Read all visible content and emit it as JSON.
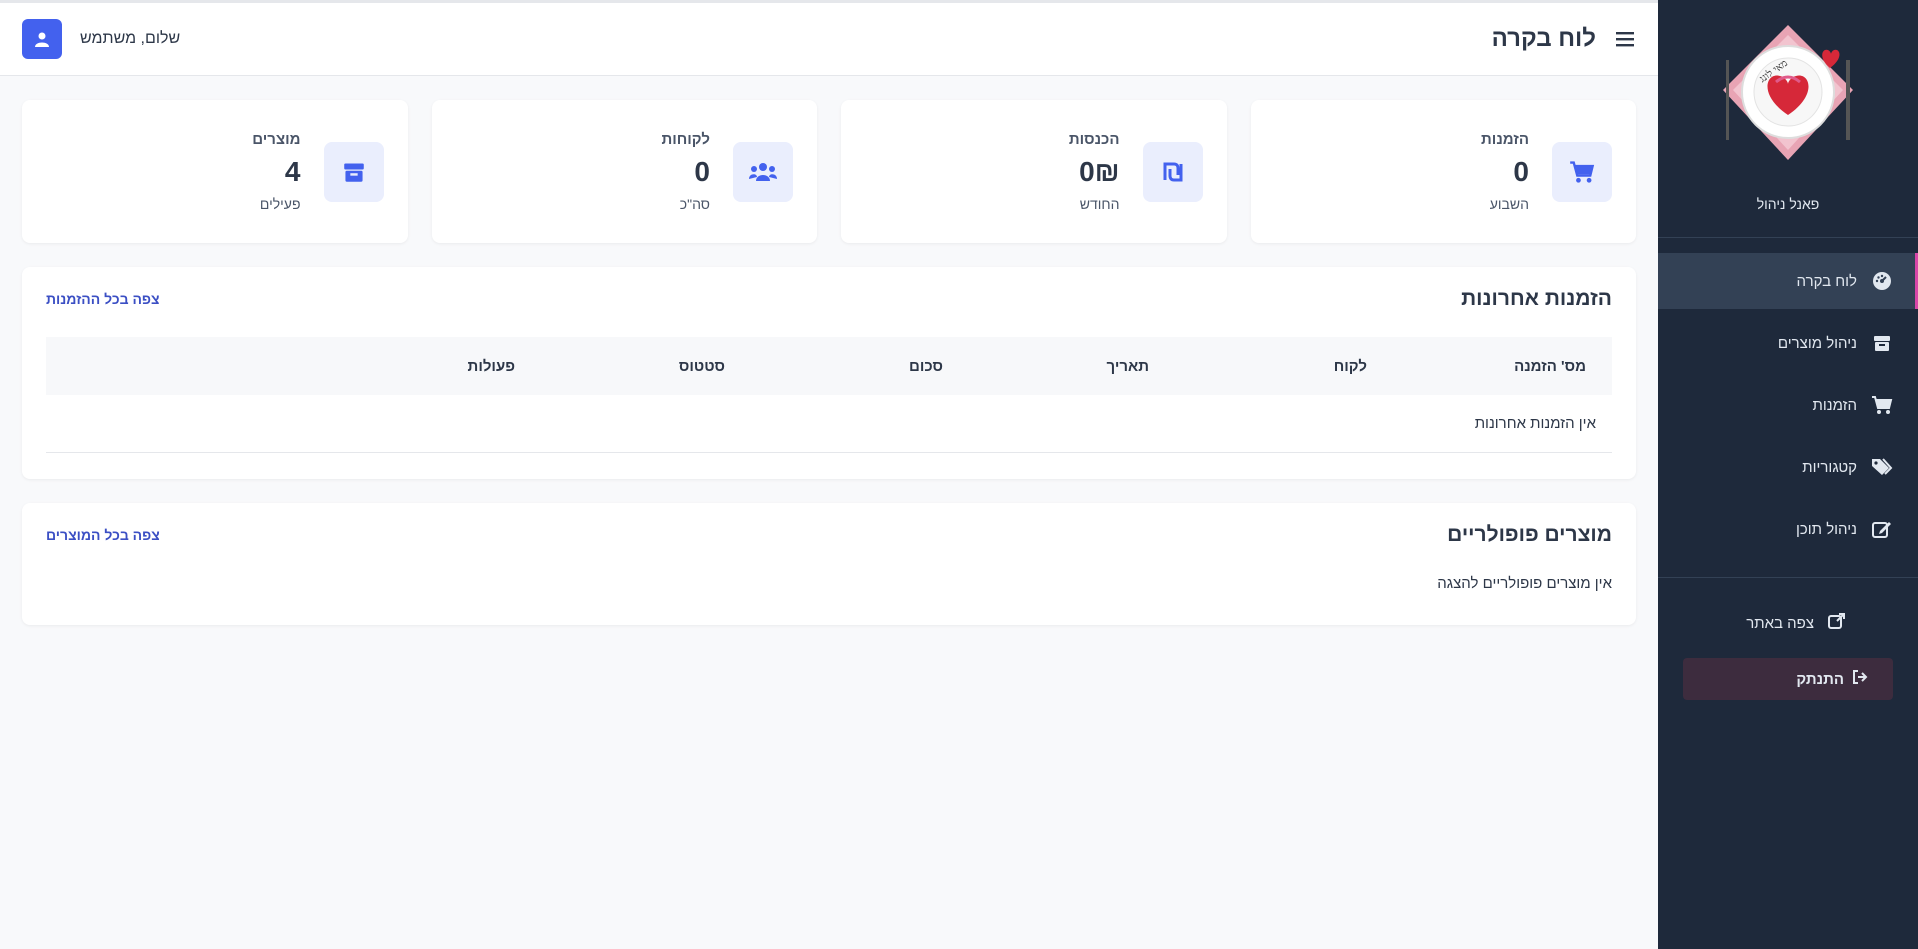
{
  "sidebar": {
    "logo_text": "מאי לונג",
    "panel_label": "פאנל ניהול",
    "items": [
      {
        "label": "לוח בקרה",
        "icon": "tachometer-icon",
        "active": true
      },
      {
        "label": "ניהול מוצרים",
        "icon": "box-icon",
        "active": false
      },
      {
        "label": "הזמנות",
        "icon": "cart-icon",
        "active": false
      },
      {
        "label": "קטגוריות",
        "icon": "tags-icon",
        "active": false
      },
      {
        "label": "ניהול תוכן",
        "icon": "edit-icon",
        "active": false
      }
    ],
    "site_link": "צפה באתר",
    "logout": "התנתק"
  },
  "header": {
    "title": "לוח בקרה",
    "greeting": "שלום, משתמש"
  },
  "stats": [
    {
      "label": "הזמנות",
      "value": "0",
      "sub": "השבוע",
      "icon": "cart-icon"
    },
    {
      "label": "הכנסות",
      "value": "0₪",
      "sub": "החודש",
      "icon": "shekel-icon"
    },
    {
      "label": "לקוחות",
      "value": "0",
      "sub": "סה\"כ",
      "icon": "users-icon"
    },
    {
      "label": "מוצרים",
      "value": "4",
      "sub": "פעילים",
      "icon": "box-icon"
    }
  ],
  "recent_orders": {
    "title": "הזמנות אחרונות",
    "view_all": "צפה בכל ההזמנות",
    "columns": [
      "מס' הזמנה",
      "לקוח",
      "תאריך",
      "סכום",
      "סטטוס",
      "פעולות"
    ],
    "empty": "אין הזמנות אחרונות"
  },
  "popular_products": {
    "title": "מוצרים פופולריים",
    "view_all": "צפה בכל המוצרים",
    "empty": "אין מוצרים פופולריים להצגה"
  },
  "colors": {
    "sidebar_bg": "#1e293b",
    "accent": "#4361ee",
    "active_marker": "#d946a8",
    "link": "#3b4fc4"
  }
}
